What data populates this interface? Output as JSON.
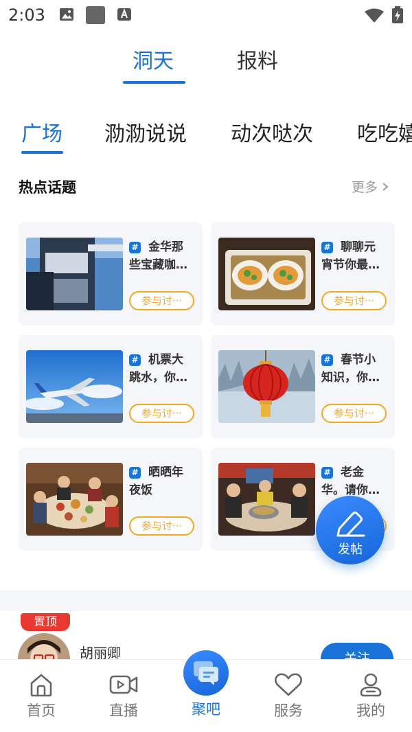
{
  "status_bar": {
    "time": "2:03"
  },
  "top_tabs": [
    {
      "label": "洞天",
      "active": true
    },
    {
      "label": "报料",
      "active": false
    }
  ],
  "sub_tabs": [
    {
      "label": "广场",
      "active": true
    },
    {
      "label": "泐泐说说",
      "active": false
    },
    {
      "label": "动次哒次",
      "active": false
    },
    {
      "label": "吃吃嬉",
      "active": false
    }
  ],
  "hot_topics": {
    "title": "热点话题",
    "more_label": "更多",
    "join_label": "参与讨···",
    "items": [
      {
        "line1": "金华那",
        "line2": "些宝藏咖…",
        "image": "cafe-building"
      },
      {
        "line1": "聊聊元",
        "line2": "宵节你最…",
        "image": "tangyuan-bowls"
      },
      {
        "line1": "机票大",
        "line2": "跳水，你…",
        "image": "airplane"
      },
      {
        "line1": "春节小",
        "line2": "知识，你…",
        "image": "red-lantern"
      },
      {
        "line1": "晒晒年",
        "line2": "夜饭",
        "image": "family-dinner"
      },
      {
        "line1": "老金",
        "line2": "华。请你…",
        "image": "hotpot-restaurant"
      }
    ]
  },
  "fab": {
    "label": "发帖"
  },
  "post_preview": {
    "pin_label": "置顶",
    "username": "胡丽卿",
    "follow_label": "关注"
  },
  "bottom_nav": [
    {
      "label": "首页",
      "icon": "home-icon",
      "active": false
    },
    {
      "label": "直播",
      "icon": "video-icon",
      "active": false
    },
    {
      "label": "聚吧",
      "icon": "chat-bubbles-icon",
      "active": true
    },
    {
      "label": "服务",
      "icon": "heart-icon",
      "active": false
    },
    {
      "label": "我的",
      "icon": "profile-icon",
      "active": false
    }
  ],
  "colors": {
    "accent": "#1a73d8",
    "join_orange": "#f5a623",
    "pin_red": "#e8382f"
  }
}
